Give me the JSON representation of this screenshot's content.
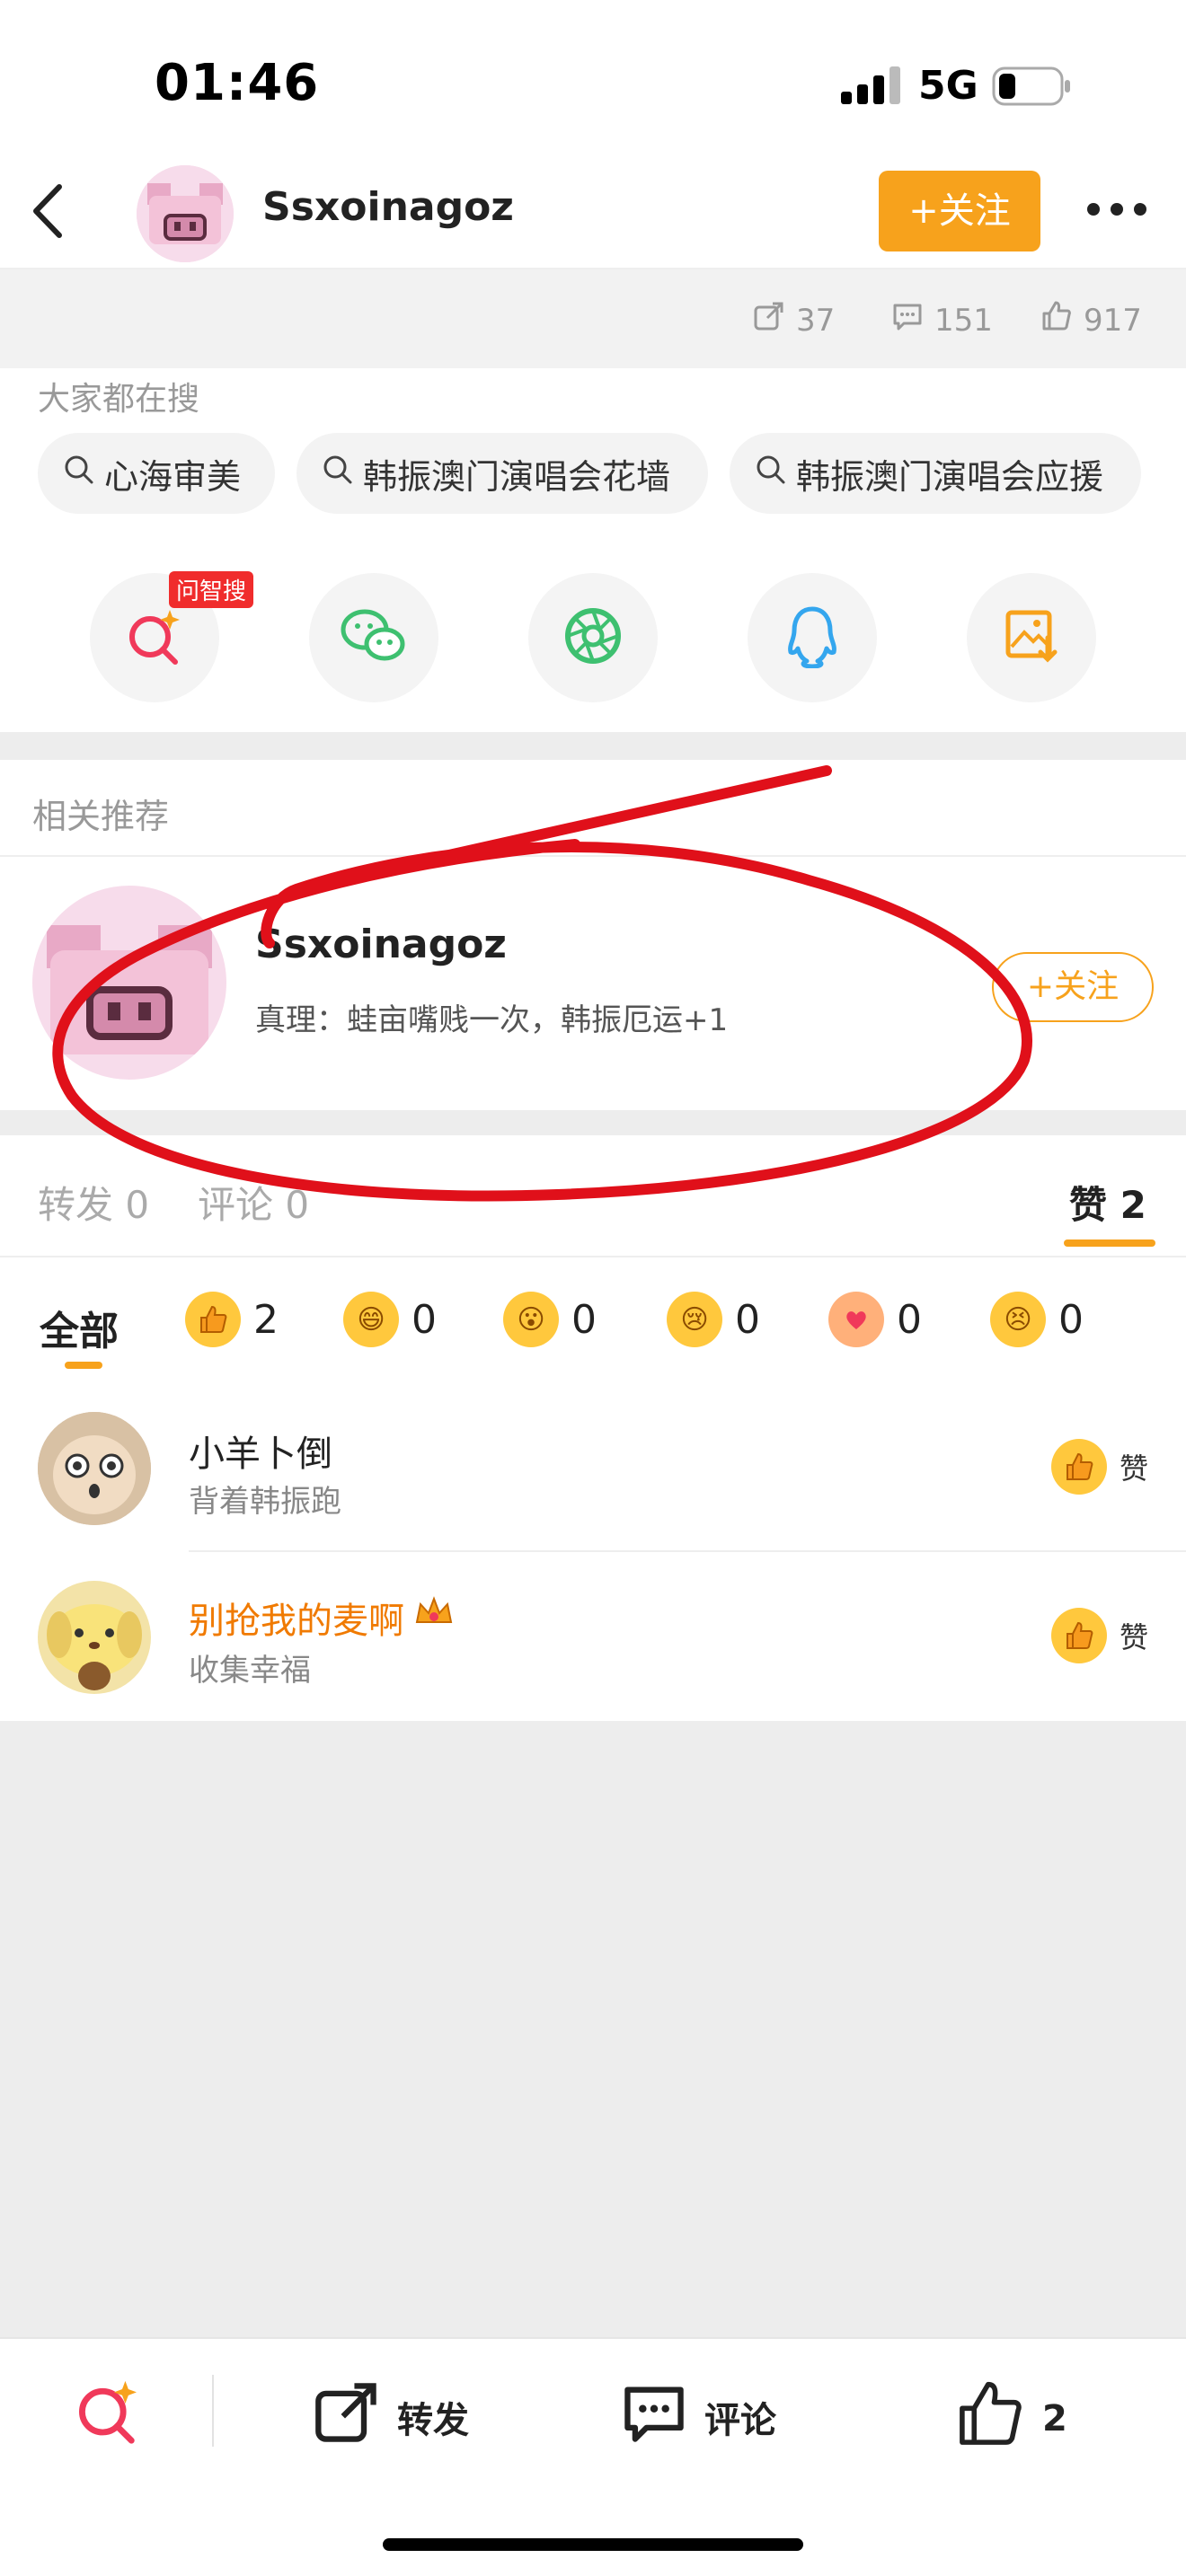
{
  "status_bar": {
    "time": "01:46",
    "network": "5G"
  },
  "header": {
    "username": "Ssxoinagoz",
    "follow_label": "+关注"
  },
  "stats": {
    "reposts": "37",
    "comments": "151",
    "likes": "917"
  },
  "search": {
    "title": "大家都在搜",
    "chips": [
      "心海审美",
      "韩振澳门演唱会花墙",
      "韩振澳门演唱会应援"
    ]
  },
  "share": {
    "ai_badge": "问智搜"
  },
  "related": {
    "title": "相关推荐",
    "name": "Ssxoinagoz",
    "desc": "真理：蛙亩嘴贱一次，韩振厄运+1",
    "follow_label": "+关注"
  },
  "tabs": {
    "repost": "转发 0",
    "comment": "评论 0",
    "likes": "赞 2"
  },
  "reactions": {
    "all_label": "全部",
    "counts": [
      "2",
      "0",
      "0",
      "0",
      "0",
      "0"
    ]
  },
  "likers": [
    {
      "name": "小羊卜倒",
      "sub": "背着韩振跑",
      "action": "赞"
    },
    {
      "name": "别抢我的麦啊",
      "sub": "收集幸福",
      "action": "赞"
    }
  ],
  "bottom_bar": {
    "repost": "转发",
    "comment": "评论",
    "like_count": "2"
  },
  "colors": {
    "accent": "#f7a21c",
    "scribble": "#e0101a",
    "highlight_name": "#f07a00"
  }
}
